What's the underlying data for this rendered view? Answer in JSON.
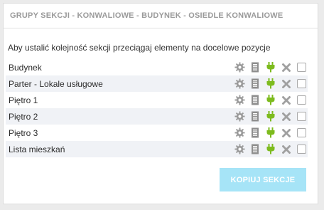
{
  "panel": {
    "title": "GRUPY SEKCJI - KONWALIOWE - BUDYNEK - OSIEDLE KONWALIOWE",
    "instruction": "Aby ustalić kolejność sekcji przeciągaj elementy na docelowe pozycje"
  },
  "sections": [
    {
      "label": "Budynek"
    },
    {
      "label": "Parter - Lokale usługowe"
    },
    {
      "label": "Piętro 1"
    },
    {
      "label": "Piętro 2"
    },
    {
      "label": "Piętro 3"
    },
    {
      "label": "Lista mieszkań"
    }
  ],
  "row_icons": [
    "gear-icon",
    "document-icon",
    "plug-icon",
    "close-icon"
  ],
  "colors": {
    "accent": "#a6e4f7",
    "plug": "#7dbb1e",
    "icon_gray": "#9a9a9a",
    "row_alt": "#f0f2f6"
  },
  "actions": {
    "copy_label": "KOPIUJ SEKCJE"
  }
}
